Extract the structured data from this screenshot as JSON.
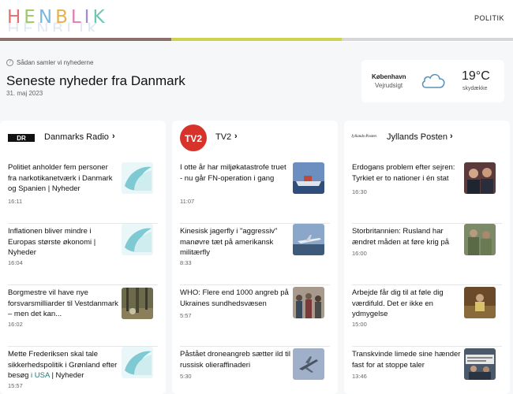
{
  "header": {
    "logo": "HENBLIK",
    "nav_item": "POLITIK",
    "stripe_colors": [
      "#8a6f6a",
      "#cdd34f",
      "#d7d7d7"
    ],
    "logo_letter_colors": [
      "#e36f6f",
      "#9fc76a",
      "#7cb7de",
      "#e8b04f",
      "#e27bb0",
      "#a28bd1",
      "#6ec6b8"
    ]
  },
  "intro": {
    "info_text": "Sådan samler vi nyhederne",
    "title": "Seneste nyheder fra Danmark",
    "date": "31. maj 2023"
  },
  "weather": {
    "city": "København",
    "label": "Vejrudsigt",
    "temperature": "19°C",
    "description": "skydække",
    "icon": "cloud-icon"
  },
  "columns": [
    {
      "source": "Danmarks Radio",
      "logo_text": "DR",
      "items": [
        {
          "title": "Politiet anholder fem personer fra narkotikanetværk i Danmark og Spanien | Nyheder",
          "time": "16:11",
          "thumb": "dr-placeholder"
        },
        {
          "title": "Inflationen bliver mindre i Europas største økonomi | Nyheder",
          "time": "16:04",
          "thumb": "dr-placeholder"
        },
        {
          "title": "Borgmestre vil have nye forsvarsmilliarder til Vestdanmark – men det kan...",
          "time": "16:02",
          "thumb": "forest-photo"
        },
        {
          "title_before": "Mette Frederiksen skal tale sikkerhedspolitik i Grønland efter besøg ",
          "title_highlight": "i USA",
          "title_after": " | Nyheder",
          "time": "15:57",
          "thumb": "dr-placeholder"
        }
      ]
    },
    {
      "source": "TV2",
      "logo_text": "TV2",
      "items": [
        {
          "title": "I otte år har miljøkatastrofe truet - nu går FN-operation i gang",
          "time": "11:07",
          "thumb": "ship-photo"
        },
        {
          "title": "Kinesisk jagerfly i \"aggressiv\" manøvre tæt på amerikansk militærfly",
          "time": "8:33",
          "thumb": "jet-photo"
        },
        {
          "title": "WHO: Flere end 1000 angreb på Ukraines sundhedsvæsen",
          "time": "5:57",
          "thumb": "crowd-photo"
        },
        {
          "title": "Påstået droneangreb sætter ild til russisk olieraffinaderi",
          "time": "5:30",
          "thumb": "drone-photo"
        }
      ]
    },
    {
      "source": "Jyllands Posten",
      "logo_text": "Jyllands-Posten",
      "items": [
        {
          "title": "Erdogans problem efter sejren: Tyrkiet er to nationer i én stat",
          "time": "16:30",
          "thumb": "portrait-photo"
        },
        {
          "title": "Storbritannien: Rusland har ændret måden at føre krig på",
          "time": "16:00",
          "thumb": "soldiers-photo"
        },
        {
          "title": "Arbejde får dig til at føle dig værdifuld. Det er ikke en ydmygelse",
          "time": "15:00",
          "thumb": "office-photo"
        },
        {
          "title": "Transkvinde limede sine hænder fast for at stoppe taler",
          "time": "13:46",
          "thumb": "protest-photo"
        }
      ]
    }
  ]
}
